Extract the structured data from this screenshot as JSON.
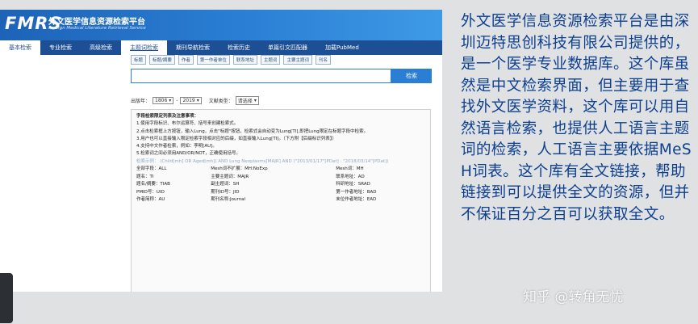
{
  "logo": {
    "mark": "FMRS",
    "title_cn": "外文医学信息资源检索平台",
    "title_en": "Foreign Medical Literature Retrieval Service"
  },
  "nav": [
    "基本检索",
    "专业检索",
    "高级检索",
    "主题词检索",
    "期刊导航检索",
    "检索历史",
    "单篇引文匹配器",
    "加载PubMed"
  ],
  "field_buttons": [
    "标题",
    "标题/摘要",
    "作者",
    "第一作者单位",
    "联系地址",
    "主题词",
    "主要主题词",
    "刊名"
  ],
  "search": {
    "value": "",
    "button": "检索"
  },
  "filters": {
    "year_label": "出版年：",
    "year_from": "1806",
    "year_sep": "-",
    "year_to": "2019",
    "type_label": "文献类型：",
    "type_value": "请选择"
  },
  "tips": {
    "heading": "字段检索限定列表及注意事项：",
    "lines": [
      "1.使用字段标识、布尔运算符、括号来创建检索式。",
      "2.点击检索框上方按钮，输入Lung，点击\"标题\"按钮，检索式会自动变为Lung[TI],即把Lung限定在标题字段中检索。",
      "3.用户也可以直接输入限定检索字段相对应的后缀，如直接输入Lung[TI]。（下方附【后缀标识列表】）",
      "4.支持中文作者检索，例如：李明[AU]。",
      "5.检索词之间必须用AND/OR/NOT，正确使用括号。"
    ],
    "example_label": "检索示例：",
    "example": "(Child[mh] OR Aged[mh]) AND Lung Neoplasms[MAJR] AND (\"2013/01/17\"[PDat] : \"2018/03/14\"[PDat])",
    "fields": [
      [
        "全部字段：ALL",
        "Mesh词不扩展：MH:NoExp",
        "Mesh词：MH"
      ],
      [
        "题名：TI",
        "主要主题词：MAJR",
        "联系地址：AD"
      ],
      [
        "题名/摘要：TIAB",
        "副主题词：SH",
        "科研地址：SRAD"
      ],
      [
        "PMID号：UID",
        "期刊ID号：JID",
        "第一作者地址：BAD"
      ],
      [
        "作者简称：AU",
        "期刊名称:Journal",
        "末位作者地址：EAD"
      ]
    ]
  },
  "description": "外文医学信息资源检索平台是由深圳迈特思创科技有限公司提供的，是一个医学专业数据库。这个库虽然是中文检索界面，但主要用于查找外文医学资料，这个库可以用自然语言检索，也提供人工语言主题词的检索，人工语言主要依据MeSH词表。这个库有全文链接，帮助链接到可以提供全文的资源，但并不保证百分之百可以获取全文。",
  "watermark": "知乎 @转角无忧",
  "colors": {
    "banner": "#1d63b7",
    "nav": "#1c4f93",
    "search_button": "#2a7fd4",
    "description_text": "#0d3f8f"
  }
}
